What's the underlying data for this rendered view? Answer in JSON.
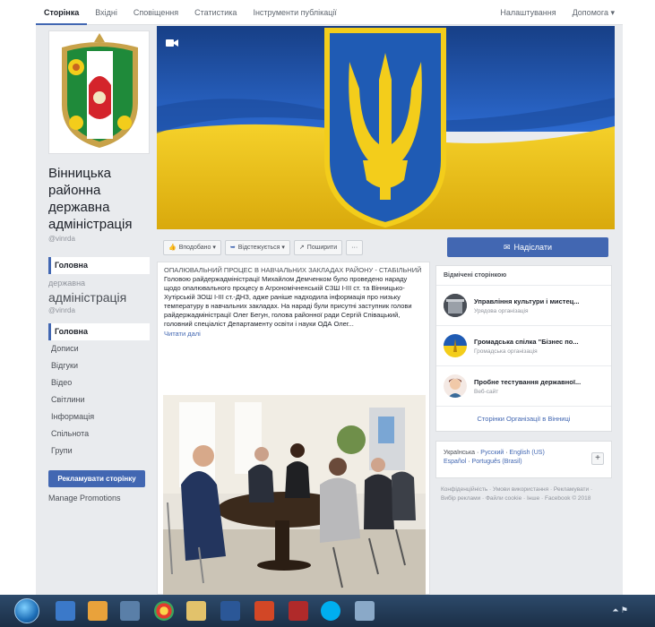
{
  "topbar": {
    "tabs": [
      "Сторінка",
      "Вхідні",
      "Сповіщення",
      "Статистика",
      "Інструменти публікації"
    ],
    "settings": "Налаштування",
    "help": "Допомога ▾"
  },
  "left": {
    "page_name": "Вінницька районна державна адміністрація",
    "handle": "@vinrda",
    "nav_active": "Головна",
    "ghost_name_1": "державна",
    "ghost_name_2": "адміністрація",
    "ghost_handle": "@vinrda",
    "nav": [
      "Головна",
      "Дописи",
      "Відгуки",
      "Відео",
      "Світлини",
      "Інформація",
      "Спільнота",
      "Групи"
    ],
    "promote": "Рекламувати сторінку",
    "manage": "Manage Promotions"
  },
  "actions": {
    "liked": "Вподобано ▾",
    "following": "Відстежується ▾",
    "share": "Поширити",
    "more": "···",
    "send": "Надіслати"
  },
  "post": {
    "title": "ОПАЛЮВАЛЬНИЙ ПРОЦЕС В НАВЧАЛЬНИХ ЗАКЛАДАХ РАЙОНУ - СТАБІЛЬНИЙ",
    "body": "Головою райдержадміністрації Михайлом Демченком було проведено нараду щодо опалювального процесу в Агрономічненській СЗШ І-ІІІ ст. та Вінницько-Хутірській ЗОШ І-ІІІ ст.-ДНЗ, адже раніше надходила інформація про низьку температуру в навчальних закладах. На нараді були присутні заступник голови райдержадміністрації Олег Бегун, голова районної ради Сергій Співацький, головний спеціаліст Департаменту освіти і науки ОДА Олег...",
    "read_more": "Читати далі"
  },
  "right": {
    "liked_header": "Відмічені сторінкою",
    "liked": [
      {
        "name": "Управління культури і мистец...",
        "category": "Урядова організація"
      },
      {
        "name": "Громадська спілка \"Бізнес по...",
        "category": "Громадська організація"
      },
      {
        "name": "Пробне тестування державної...",
        "category": "Веб-сайт"
      }
    ],
    "see_all": "Сторінки Організації в Вінниці",
    "lang_current": "Українська",
    "langs": [
      "Русский",
      "English (US)",
      "Español",
      "Português (Brasil)"
    ],
    "plus": "+",
    "footer": "Конфіденційність · Умови використання · Рекламувати · Вибір реклами · Файли cookie · Інше · Facebook © 2018"
  },
  "colors": {
    "fb_blue": "#4267b2",
    "ua_blue": "#1f5bb4",
    "ua_yellow": "#f3cd1b"
  }
}
